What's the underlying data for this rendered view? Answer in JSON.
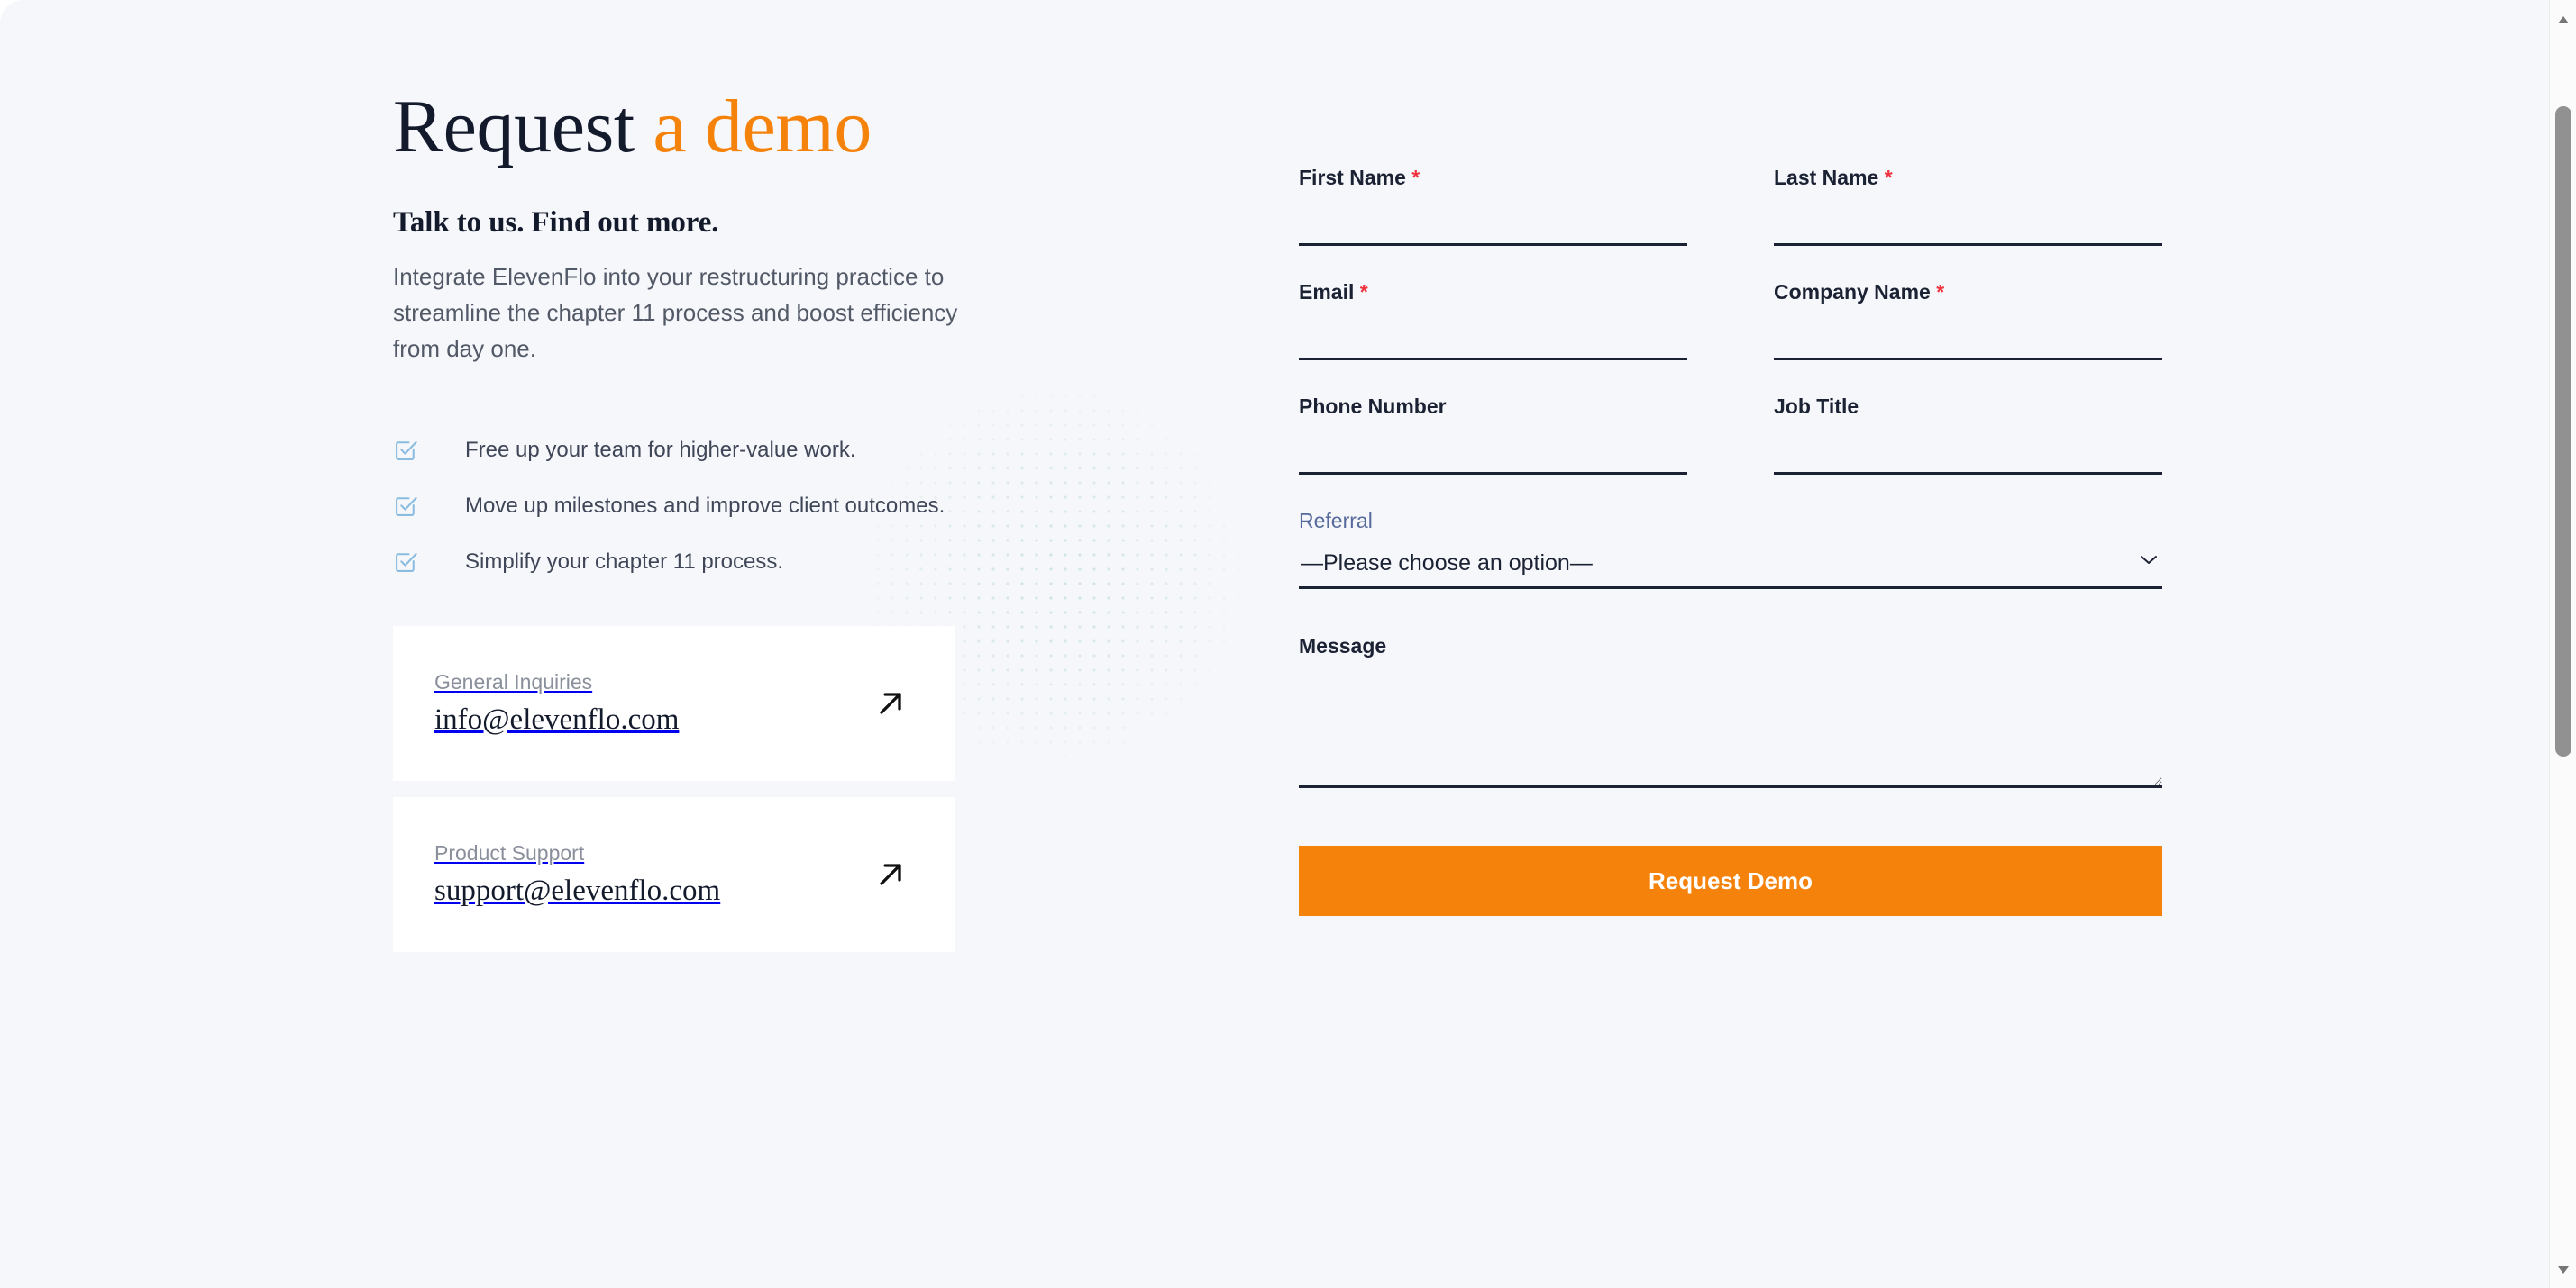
{
  "hero": {
    "title_main": "Request ",
    "title_accent": "a demo",
    "subheading": "Talk to us. Find out more.",
    "paragraph": "Integrate ElevenFlo into your restructuring practice to streamline the chapter 11 process and boost efficiency from day one."
  },
  "benefits": [
    {
      "icon": "checkbox-check-icon",
      "text": "Free up your team for higher-value work."
    },
    {
      "icon": "checkbox-check-icon",
      "text": "Move up milestones and improve client outcomes."
    },
    {
      "icon": "checkbox-check-icon",
      "text": "Simplify your chapter 11 process."
    }
  ],
  "contact_cards": [
    {
      "label": "General Inquiries",
      "email": "info@elevenflo.com",
      "icon": "arrow-up-right-icon"
    },
    {
      "label": "Product Support",
      "email": "support@elevenflo.com",
      "icon": "arrow-up-right-icon"
    }
  ],
  "form": {
    "first_name": {
      "label": "First Name",
      "required": "*",
      "value": "",
      "placeholder": ""
    },
    "last_name": {
      "label": "Last Name",
      "required": "*",
      "value": "",
      "placeholder": ""
    },
    "email": {
      "label": "Email",
      "required": "*",
      "value": "",
      "placeholder": ""
    },
    "company_name": {
      "label": "Company Name",
      "required": "*",
      "value": "",
      "placeholder": ""
    },
    "phone_number": {
      "label": "Phone Number",
      "value": "",
      "placeholder": ""
    },
    "job_title": {
      "label": "Job Title",
      "value": "",
      "placeholder": ""
    },
    "referral": {
      "label": "Referral",
      "selected": "—Please choose an option—",
      "options": [
        "—Please choose an option—"
      ],
      "caret_icon": "chevron-down-icon"
    },
    "message": {
      "label": "Message",
      "value": "",
      "placeholder": ""
    },
    "submit_label": "Request Demo"
  },
  "colors": {
    "accent_orange": "#f5820b",
    "page_background": "#f6f7fb",
    "card_background": "#ffffff",
    "label_dark": "#1b2233",
    "required_red": "#f0343f",
    "referral_label_blue": "#566b9c",
    "checkbox_blue": "#8cbde0",
    "dot_grid_teal": "#b9d9d4"
  },
  "scrollbar": {
    "up_icon": "scroll-up-arrow-icon",
    "down_icon": "scroll-down-arrow-icon"
  }
}
